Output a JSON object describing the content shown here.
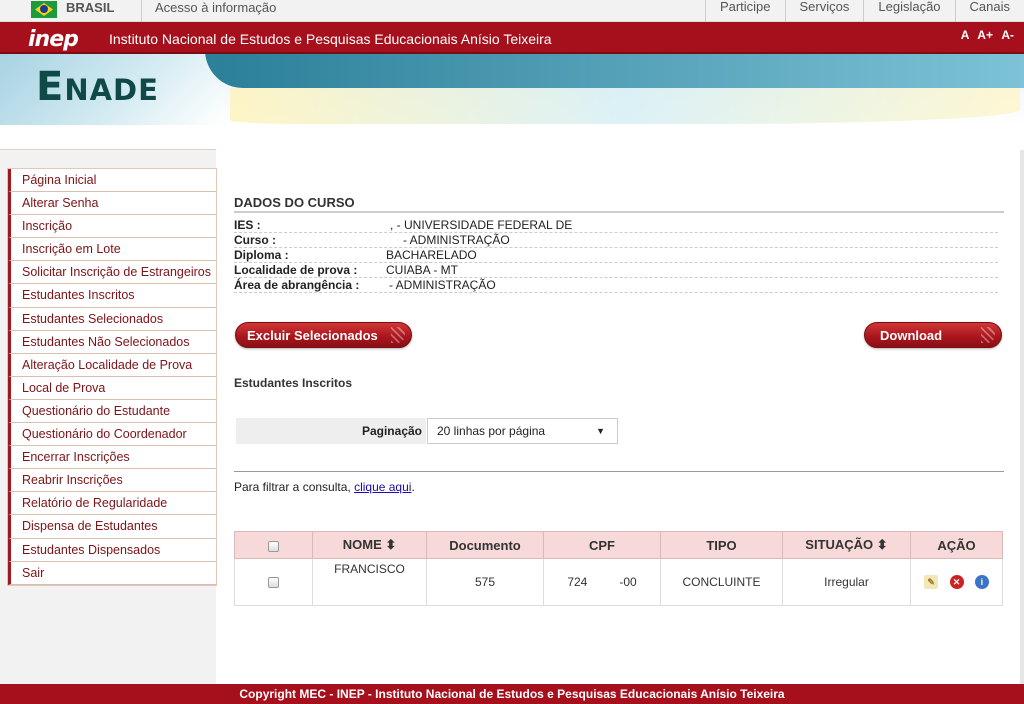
{
  "govbar": {
    "country": "BRASIL",
    "access": "Acesso à informação",
    "nav": [
      "Participe",
      "Serviços",
      "Legislação",
      "Canais"
    ]
  },
  "inepbar": {
    "logo": "inep",
    "institute": "Instituto Nacional de Estudos e Pesquisas Educacionais Anísio Teixeira",
    "font_controls": [
      "A",
      "A+",
      "A-"
    ]
  },
  "banner": {
    "title_first": "E",
    "title_rest": "NADE"
  },
  "sidebar": {
    "items": [
      "Página Inicial",
      "Alterar Senha",
      "Inscrição",
      "Inscrição em Lote",
      "Solicitar Inscrição de Estrangeiros",
      "Estudantes Inscritos",
      "Estudantes Selecionados",
      "Estudantes Não Selecionados",
      "Alteração Localidade de Prova",
      "Local de Prova",
      "Questionário do Estudante",
      "Questionário do Coordenador",
      "Encerrar Inscrições",
      "Reabrir Inscrições",
      "Relatório de Regularidade",
      "Dispensa de Estudantes",
      "Estudantes Dispensados",
      "Sair"
    ]
  },
  "course": {
    "title": "DADOS DO CURSO",
    "fields": [
      {
        "label": "IES :",
        "value": ", - UNIVERSIDADE FEDERAL DE"
      },
      {
        "label": "Curso :",
        "value": "- ADMINISTRAÇÃO"
      },
      {
        "label": "Diploma :",
        "value": "BACHARELADO"
      },
      {
        "label": "Localidade de prova :",
        "value": "CUIABA - MT"
      },
      {
        "label": "Área de abrangência :",
        "value": "- ADMINISTRAÇÃO"
      }
    ]
  },
  "actions": {
    "delete_selected": "Excluir Selecionados",
    "download": "Download"
  },
  "list": {
    "heading": "Estudantes Inscritos"
  },
  "pagination": {
    "label": "Paginação",
    "selected": "20 linhas por página"
  },
  "filter": {
    "text": "Para filtrar a consulta, ",
    "link": "clique aqui",
    "suffix": "."
  },
  "table": {
    "headers": [
      "NOME",
      "Documento",
      "CPF",
      "TIPO",
      "SITUAÇÃO",
      "AÇÃO"
    ],
    "sortable": [
      "NOME",
      "SITUAÇÃO"
    ],
    "rows": [
      {
        "nome": "FRANCISCO",
        "documento": "575",
        "cpf_start": "724",
        "cpf_end": "-00",
        "tipo": "CONCLUINTE",
        "situacao": "Irregular"
      }
    ]
  },
  "footer": "Copyright MEC - INEP - Instituto Nacional de Estudos e Pesquisas Educacionais Anísio Teixeira",
  "colors": {
    "brand_red": "#a6101c",
    "header_pink": "#f7d9d9",
    "teal": "#0f4a48"
  }
}
